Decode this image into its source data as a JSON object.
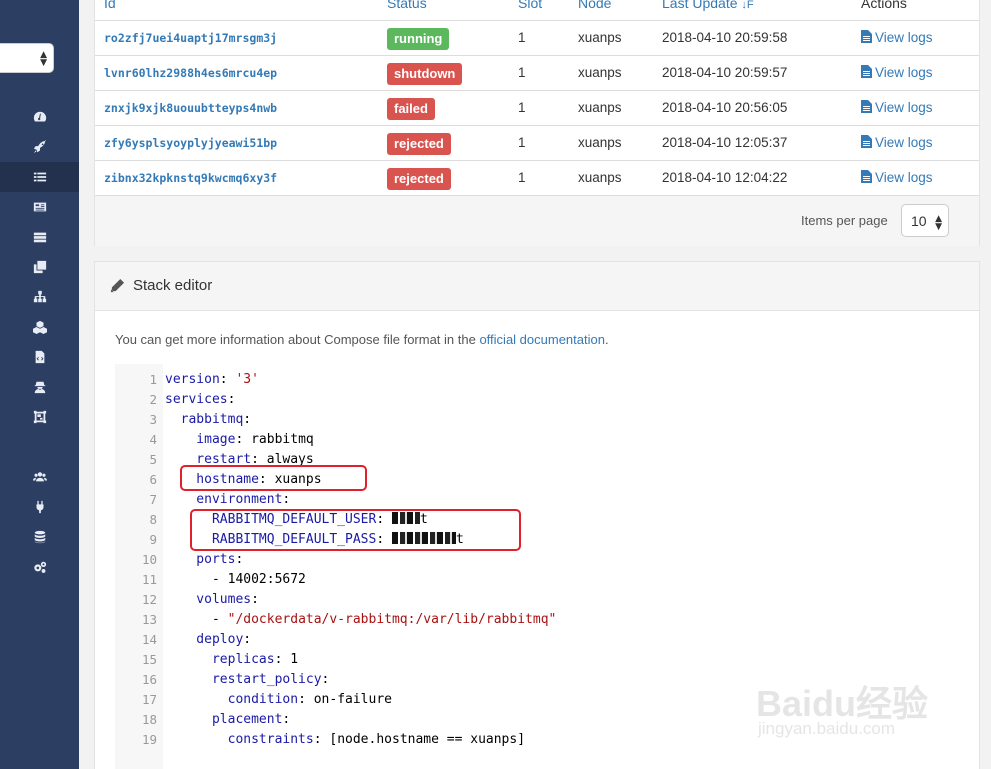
{
  "table": {
    "headers": {
      "id": "Id",
      "status": "Status",
      "slot": "Slot",
      "node": "Node",
      "last_update": "Last Update",
      "sort_indicator": "↓F",
      "actions": "Actions"
    },
    "rows": [
      {
        "id": "ro2zfj7uei4uaptj17mrsgm3j",
        "status": "running",
        "status_color": "#5cb85c",
        "slot": "1",
        "node": "xuanps",
        "updated": "2018-04-10 20:59:58",
        "action": "View logs"
      },
      {
        "id": "lvnr60lhz2988h4es6mrcu4ep",
        "status": "shutdown",
        "status_color": "#d9534f",
        "slot": "1",
        "node": "xuanps",
        "updated": "2018-04-10 20:59:57",
        "action": "View logs"
      },
      {
        "id": "znxjk9xjk8uouubtteyps4nwb",
        "status": "failed",
        "status_color": "#d9534f",
        "slot": "1",
        "node": "xuanps",
        "updated": "2018-04-10 20:56:05",
        "action": "View logs"
      },
      {
        "id": "zfy6ysplsyoyplyjyeawi51bp",
        "status": "rejected",
        "status_color": "#d9534f",
        "slot": "1",
        "node": "xuanps",
        "updated": "2018-04-10 12:05:37",
        "action": "View logs"
      },
      {
        "id": "zibnx32kpknstq9kwcmq6xy3f",
        "status": "rejected",
        "status_color": "#d9534f",
        "slot": "1",
        "node": "xuanps",
        "updated": "2018-04-10 12:04:22",
        "action": "View logs"
      }
    ],
    "items_per_page_label": "Items per page",
    "items_per_page_value": "10"
  },
  "editor": {
    "title": "Stack editor",
    "info_prefix": "You can get more information about Compose file format in the ",
    "info_link": "official documentation",
    "info_suffix": ".",
    "lines": [
      {
        "n": "1",
        "key": "version",
        "val": "'3'",
        "val_type": "string"
      },
      {
        "n": "2",
        "key": "services",
        "val": "",
        "val_type": ""
      },
      {
        "n": "3",
        "key": "  rabbitmq",
        "val": "",
        "val_type": ""
      },
      {
        "n": "4",
        "key": "    image",
        "val": "rabbitmq",
        "val_type": "plain"
      },
      {
        "n": "5",
        "key": "    restart",
        "val": "always",
        "val_type": "plain"
      },
      {
        "n": "6",
        "key": "    hostname",
        "val": "xuanps",
        "val_type": "plain"
      },
      {
        "n": "7",
        "key": "    environment",
        "val": "",
        "val_type": ""
      },
      {
        "n": "8",
        "key": "      RABBITMQ_DEFAULT_USER",
        "val": "t",
        "val_type": "redacted-short"
      },
      {
        "n": "9",
        "key": "      RABBITMQ_DEFAULT_PASS",
        "val": "t",
        "val_type": "redacted-long"
      },
      {
        "n": "10",
        "key": "    ports",
        "val": "",
        "val_type": ""
      },
      {
        "n": "11",
        "key": "",
        "val": "      - 14002:5672",
        "val_type": "plain"
      },
      {
        "n": "12",
        "key": "    volumes",
        "val": "",
        "val_type": ""
      },
      {
        "n": "13",
        "key": "",
        "val": "      - \"/dockerdata/v-rabbitmq:/var/lib/rabbitmq\"",
        "val_type": "dash-string"
      },
      {
        "n": "14",
        "key": "    deploy",
        "val": "",
        "val_type": ""
      },
      {
        "n": "15",
        "key": "      replicas",
        "val": "1",
        "val_type": "plain"
      },
      {
        "n": "16",
        "key": "      restart_policy",
        "val": "",
        "val_type": ""
      },
      {
        "n": "17",
        "key": "        condition",
        "val": "on-failure",
        "val_type": "plain"
      },
      {
        "n": "18",
        "key": "      placement",
        "val": "",
        "val_type": ""
      },
      {
        "n": "19",
        "key": "        constraints",
        "val": "[node.hostname == xuanps]",
        "val_type": "plain"
      }
    ]
  },
  "watermark": {
    "brand": "Baidu经验",
    "url": "jingyan.baidu.com"
  },
  "sidebar": {
    "icons": [
      "dashboard-icon",
      "rocket-icon",
      "list-icon",
      "newspaper-icon",
      "tasks-icon",
      "clone-icon",
      "sitemap-icon",
      "cubes-icon",
      "file-code-icon",
      "user-secret-icon",
      "object-group-icon",
      "users-icon",
      "plug-icon",
      "database-icon",
      "cogs-icon"
    ]
  }
}
